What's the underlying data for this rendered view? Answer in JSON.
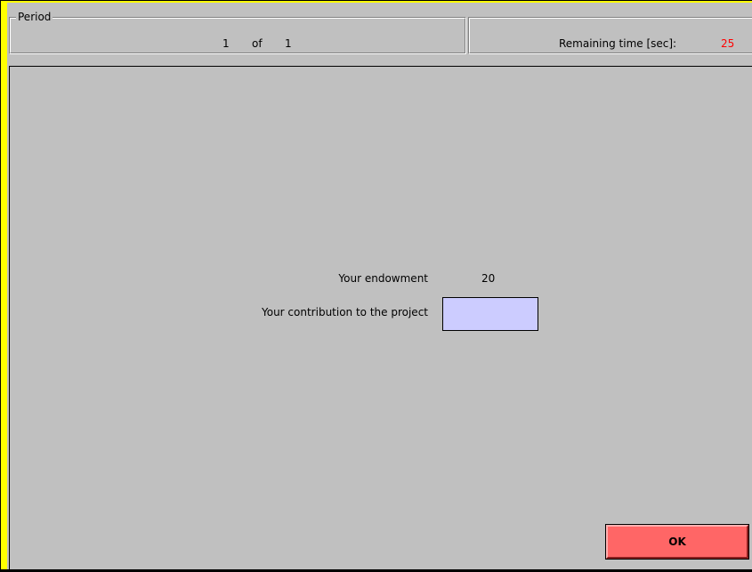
{
  "header": {
    "period": {
      "legend": "Period",
      "current": "1",
      "of_label": "of",
      "total": "1"
    },
    "timer": {
      "label": "Remaining time [sec]:",
      "value": "25",
      "value_color": "#ff0000"
    }
  },
  "form": {
    "endowment_label": "Your endowment",
    "endowment_value": "20",
    "contribution_label": "Your contribution to the project",
    "contribution_value": "",
    "contribution_placeholder": ""
  },
  "actions": {
    "ok_label": "OK"
  },
  "colors": {
    "frame_accent": "#ffff00",
    "panel_background": "#c0c0c0",
    "input_background": "#ccccff",
    "ok_button": "#ff6666"
  }
}
